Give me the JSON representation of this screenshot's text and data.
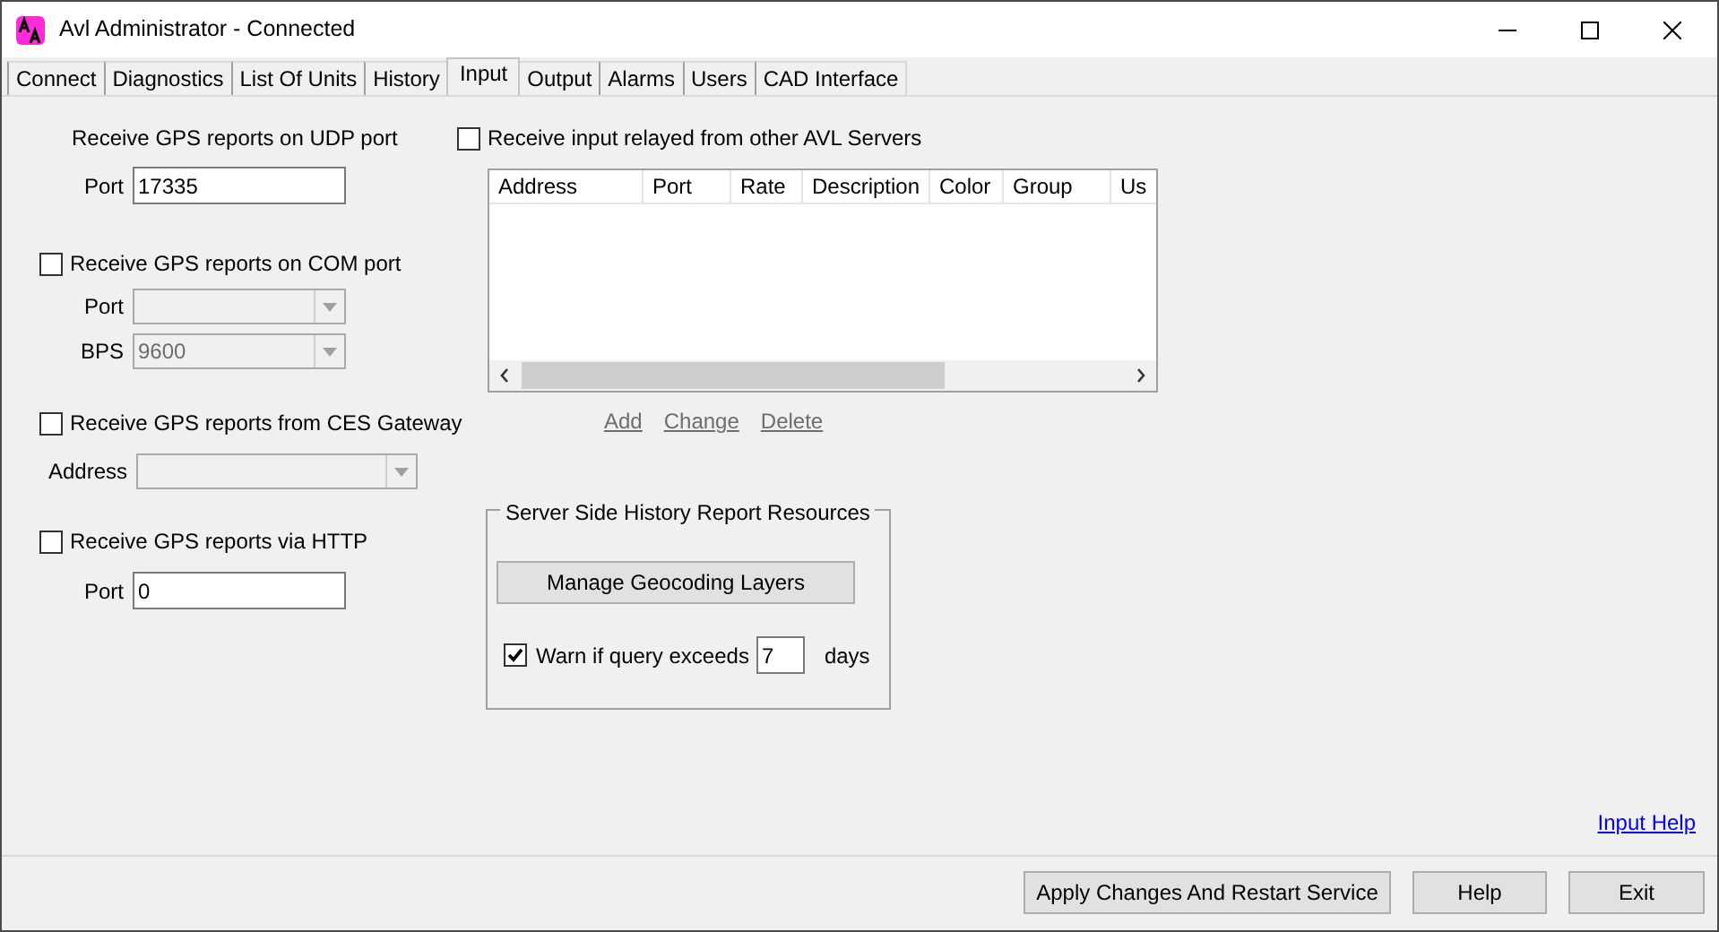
{
  "window": {
    "title": "Avl Administrator - Connected"
  },
  "tabs": [
    {
      "label": "Connect",
      "selected": false
    },
    {
      "label": "Diagnostics",
      "selected": false
    },
    {
      "label": "List Of Units",
      "selected": false
    },
    {
      "label": "History",
      "selected": false
    },
    {
      "label": "Input",
      "selected": true
    },
    {
      "label": "Output",
      "selected": false
    },
    {
      "label": "Alarms",
      "selected": false
    },
    {
      "label": "Users",
      "selected": false
    },
    {
      "label": "CAD Interface",
      "selected": false
    }
  ],
  "udp": {
    "heading": "Receive GPS reports on UDP port",
    "port_label": "Port",
    "port_value": "17335"
  },
  "com": {
    "label": "Receive GPS reports on COM port",
    "checked": false,
    "fields": [
      {
        "label": "Port",
        "disabled": true
      },
      {
        "label": "BPS",
        "value": "9600",
        "disabled": true
      }
    ]
  },
  "ces": {
    "label": "Receive GPS reports from CES Gateway",
    "checked": false,
    "fields": [
      {
        "label": "Address",
        "disabled": true
      }
    ]
  },
  "http": {
    "label": "Receive GPS reports via HTTP",
    "checked": false,
    "port_label": "Port",
    "port_value": "0"
  },
  "relay": {
    "label": "Receive input relayed from other AVL Servers",
    "checked": false,
    "columns": [
      "Address",
      "Port",
      "Rate",
      "Description",
      "Color",
      "Group",
      "Us"
    ],
    "links": [
      "Add",
      "Change",
      "Delete"
    ]
  },
  "history": {
    "title": "Server Side History Report Resources",
    "button": "Manage Geocoding Layers",
    "warn_label": "Warn if query exceeds",
    "warn_checked": true,
    "days_value": "7",
    "days_unit": "days"
  },
  "help_link": "Input Help",
  "buttons": [
    "Apply Changes And Restart Service",
    "Help",
    "Exit"
  ]
}
